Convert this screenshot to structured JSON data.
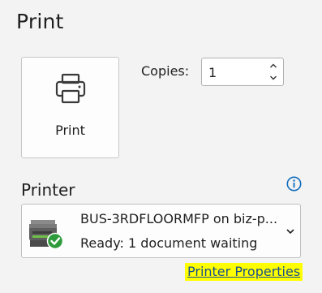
{
  "page": {
    "title": "Print"
  },
  "print_action": {
    "label": "Print",
    "icon": "printer-icon"
  },
  "copies": {
    "label": "Copies:",
    "value": "1",
    "up_icon": "chevron-up-icon",
    "down_icon": "chevron-down-icon"
  },
  "printer": {
    "heading": "Printer",
    "info_icon": "info-icon",
    "selected_name": "BUS-3RDFLOORMFP on biz-p...",
    "selected_status": "Ready: 1 document waiting",
    "device_icon": "network-printer-ready-icon",
    "dropdown_icon": "chevron-down-icon",
    "properties_link": "Printer Properties"
  },
  "colors": {
    "background": "#f3f3f3",
    "link": "#1a4f8c",
    "highlight": "#ffff00",
    "info_blue": "#0f6cbd",
    "status_green": "#2e9b3a"
  }
}
